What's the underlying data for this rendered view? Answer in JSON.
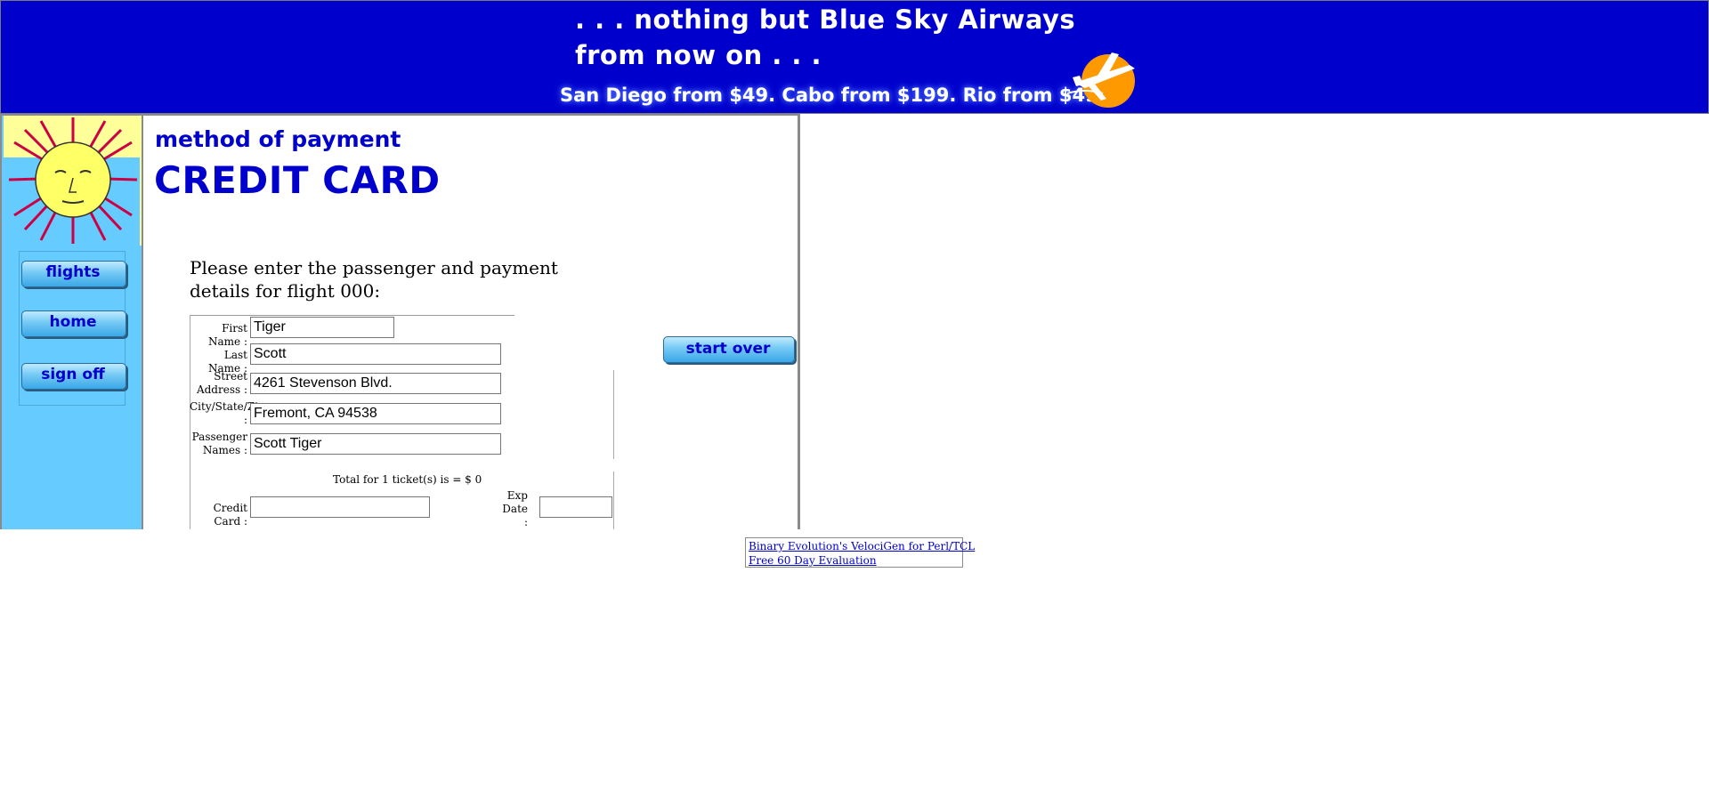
{
  "banner": {
    "line1": ". . . nothing but Blue Sky Airways",
    "line2": "from now on . . .",
    "line3": "San Diego from $49. Cabo from $199. Rio from $499.",
    "color": "#0000cc"
  },
  "nav": {
    "items": [
      {
        "label": "flights"
      },
      {
        "label": "home"
      },
      {
        "label": "sign off"
      }
    ]
  },
  "main": {
    "heading_small": "method of payment",
    "heading_big": "CREDIT CARD",
    "intro": "Please enter the passenger and payment details for flight 000:",
    "start_over_label": "start over",
    "form": {
      "first_name_label": "First Name :",
      "first_name_value": "Tiger",
      "last_name_label": "Last Name :",
      "last_name_value": "Scott",
      "street_label_1": "Street",
      "street_label_2": "Address :",
      "street_value": "4261 Stevenson Blvd.",
      "city_label_1": "City/State/Zip",
      "city_label_2": ":",
      "city_value": "Fremont, CA 94538",
      "passenger_label_1": "Passenger",
      "passenger_label_2": "Names :",
      "passenger_value": "Scott Tiger",
      "total_text": "Total for 1 ticket(s) is = $ 0",
      "credit_card_label": "Credit Card :",
      "credit_card_value": "",
      "exp_label_1": "Exp",
      "exp_label_2": "Date",
      "exp_label_3": ":",
      "exp_value": ""
    }
  },
  "ad": {
    "line1": "Binary Evolution's VelociGen for Perl/TCL",
    "line2": "Free 60 Day Evaluation"
  }
}
